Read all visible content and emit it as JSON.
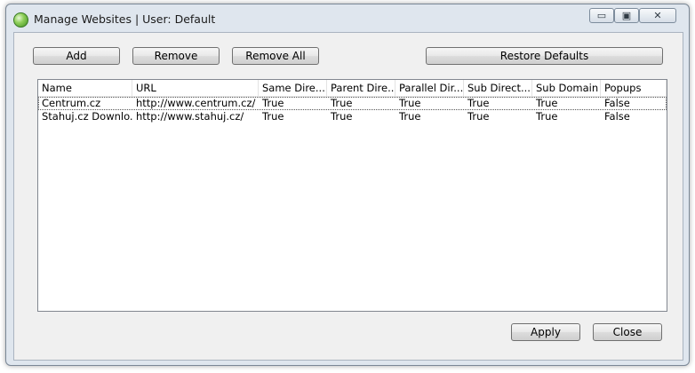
{
  "window": {
    "title": "Manage Websites | User: Default",
    "controls": {
      "minimize": "▭",
      "maximize": "▣",
      "close": "✕"
    }
  },
  "toolbar": {
    "add_label": "Add",
    "remove_label": "Remove",
    "remove_all_label": "Remove All",
    "restore_label": "Restore Defaults"
  },
  "table": {
    "columns": [
      "Name",
      "URL",
      "Same Dire...",
      "Parent Dire...",
      "Parallel Dir...",
      "Sub Direct...",
      "Sub Domain",
      "Popups"
    ],
    "rows": [
      [
        "Centrum.cz",
        "http://www.centrum.cz/",
        "True",
        "True",
        "True",
        "True",
        "True",
        "False"
      ],
      [
        "Stahuj.cz Downlo...",
        "http://www.stahuj.cz/",
        "True",
        "True",
        "True",
        "True",
        "True",
        "False"
      ]
    ]
  },
  "footer": {
    "apply_label": "Apply",
    "close_label": "Close"
  }
}
